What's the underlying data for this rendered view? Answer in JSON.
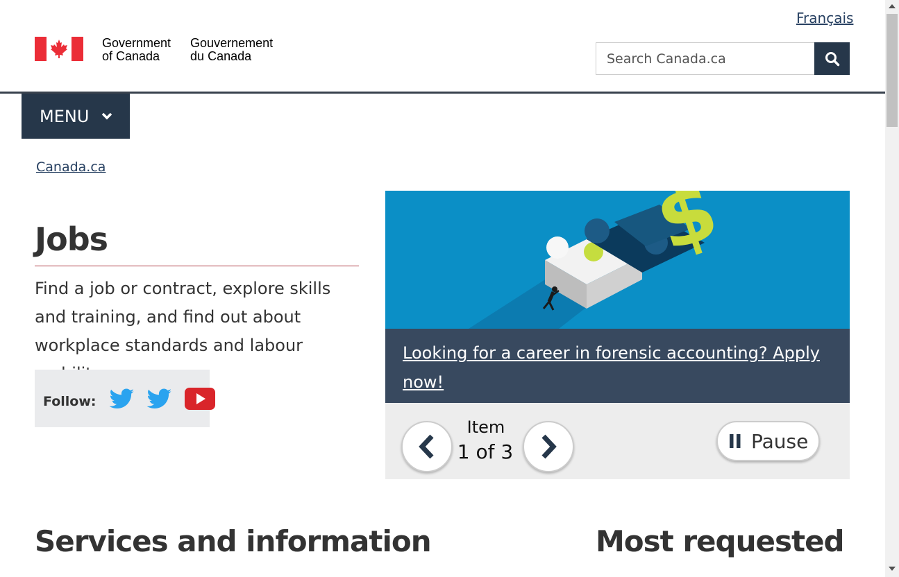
{
  "header": {
    "language_link": "Français",
    "signature_en_line1": "Government",
    "signature_en_line2": "of Canada",
    "signature_fr_line1": "Gouvernement",
    "signature_fr_line2": "du Canada",
    "search_placeholder": "Search Canada.ca",
    "menu_label": "MENU"
  },
  "breadcrumb": {
    "items": [
      "Canada.ca"
    ]
  },
  "main": {
    "title": "Jobs",
    "intro": "Find a job or contract, explore skills and training, and find out about workplace standards and labour mobility.",
    "follow_label": "Follow:",
    "social_icons": [
      "twitter-icon",
      "twitter-icon",
      "youtube-icon"
    ]
  },
  "carousel": {
    "caption": "Looking for a career in forensic accounting? Apply now!",
    "item_label": "Item",
    "item_count": "1 of 3",
    "pause_label": "Pause"
  },
  "sections": {
    "services_heading": "Services and information",
    "most_requested_heading": "Most requested"
  },
  "colors": {
    "primary_dark": "#26374a",
    "link": "#284162",
    "flag_red": "#eb2d37",
    "title_rule": "#af3c43",
    "carousel_bg": "#0b8fc6",
    "caption_bg": "#38495f"
  }
}
